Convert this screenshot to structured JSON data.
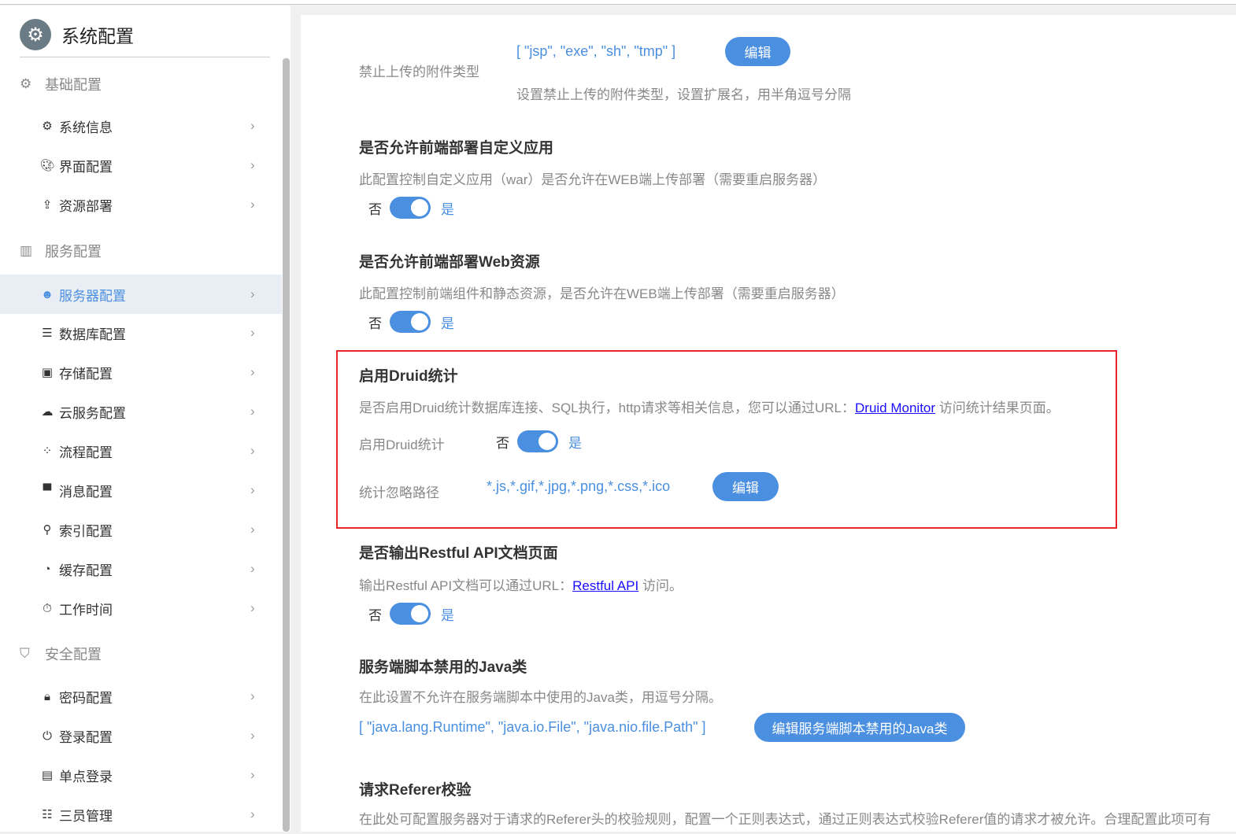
{
  "sidebar": {
    "title": "系统配置",
    "groups": [
      {
        "label": "基础配置",
        "items": [
          "系统信息",
          "界面配置",
          "资源部署"
        ]
      },
      {
        "label": "服务配置",
        "items": [
          "服务器配置",
          "数据库配置",
          "存储配置",
          "云服务配置",
          "流程配置",
          "消息配置",
          "索引配置",
          "缓存配置",
          "工作时间"
        ]
      },
      {
        "label": "安全配置",
        "items": [
          "密码配置",
          "登录配置",
          "单点登录",
          "三员管理"
        ]
      }
    ],
    "active": "服务器配置"
  },
  "main": {
    "upload": {
      "label": "禁止上传的附件类型",
      "value": "[ \"jsp\", \"exe\", \"sh\", \"tmp\" ]",
      "button": "编辑",
      "desc": "设置禁止上传的附件类型，设置扩展名，用半角逗号分隔"
    },
    "custom_app": {
      "title": "是否允许前端部署自定义应用",
      "desc": "此配置控制自定义应用（war）是否允许在WEB端上传部署（需要重启服务器）",
      "off": "否",
      "on": "是"
    },
    "web_res": {
      "title": "是否允许前端部署Web资源",
      "desc": "此配置控制前端组件和静态资源，是否允许在WEB端上传部署（需要重启服务器）",
      "off": "否",
      "on": "是"
    },
    "druid": {
      "title": "启用Druid统计",
      "desc_pre": "是否启用Druid统计数据库连接、SQL执行，http请求等相关信息，您可以通过URL：",
      "link": "Druid Monitor",
      "desc_post": "访问统计结果页面。",
      "enable_label": "启用Druid统计",
      "off": "否",
      "on": "是",
      "ignore_label": "统计忽略路径",
      "ignore_value": "*.js,*.gif,*.jpg,*.png,*.css,*.ico",
      "button": "编辑"
    },
    "restful": {
      "title": "是否输出Restful API文档页面",
      "desc_pre": "输出Restful API文档可以通过URL：",
      "link": "Restful API",
      "desc_post": "访问。",
      "off": "否",
      "on": "是"
    },
    "java": {
      "title": "服务端脚本禁用的Java类",
      "desc": "在此设置不允许在服务端脚本中使用的Java类，用逗号分隔。",
      "value": "[ \"java.lang.Runtime\", \"java.io.File\", \"java.nio.file.Path\" ]",
      "button": "编辑服务端脚本禁用的Java类"
    },
    "referer": {
      "title": "请求Referer校验",
      "desc": "在此处可配置服务器对于请求的Referer头的校验规则，配置一个正则表达式，通过正则表达式校验Referer值的请求才被允许。合理配置此项可有"
    }
  }
}
